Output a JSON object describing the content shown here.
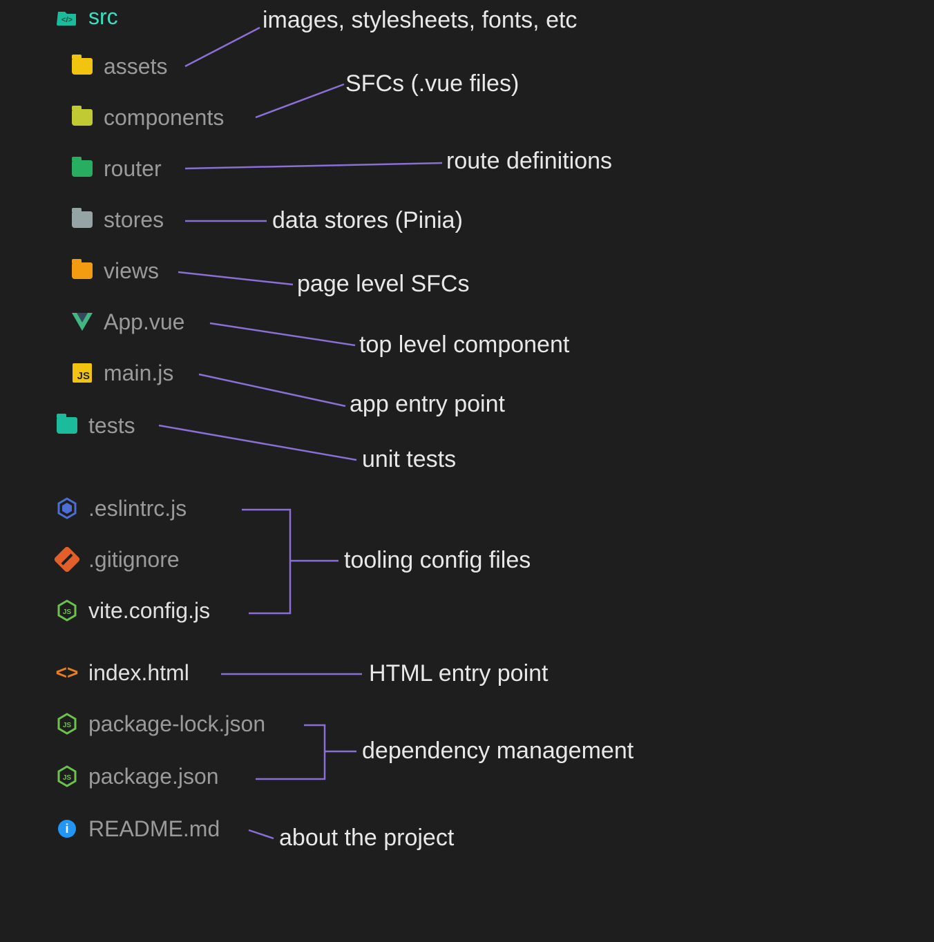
{
  "tree": {
    "src": {
      "label": "src",
      "desc": "images, stylesheets, fonts, etc"
    },
    "assets": {
      "label": "assets"
    },
    "components": {
      "label": "components",
      "desc": "SFCs (.vue files)"
    },
    "router": {
      "label": "router",
      "desc": "route definitions"
    },
    "stores": {
      "label": "stores",
      "desc": "data stores (Pinia)"
    },
    "views": {
      "label": "views",
      "desc": "page level SFCs"
    },
    "appvue": {
      "label": "App.vue",
      "desc": "top level component"
    },
    "mainjs": {
      "label": "main.js",
      "desc": "app entry point"
    },
    "tests": {
      "label": "tests",
      "desc": "unit tests"
    },
    "eslintrc": {
      "label": ".eslintrc.js"
    },
    "gitignore": {
      "label": ".gitignore"
    },
    "viteconfig": {
      "label": "vite.config.js",
      "desc": "tooling config files"
    },
    "indexhtml": {
      "label": "index.html",
      "desc": "HTML entry point"
    },
    "packagelock": {
      "label": "package-lock.json"
    },
    "packagejson": {
      "label": "package.json",
      "desc": "dependency management"
    },
    "readme": {
      "label": "README.md",
      "desc": "about the project"
    }
  },
  "icon_text": {
    "js": "JS",
    "info": "i"
  }
}
